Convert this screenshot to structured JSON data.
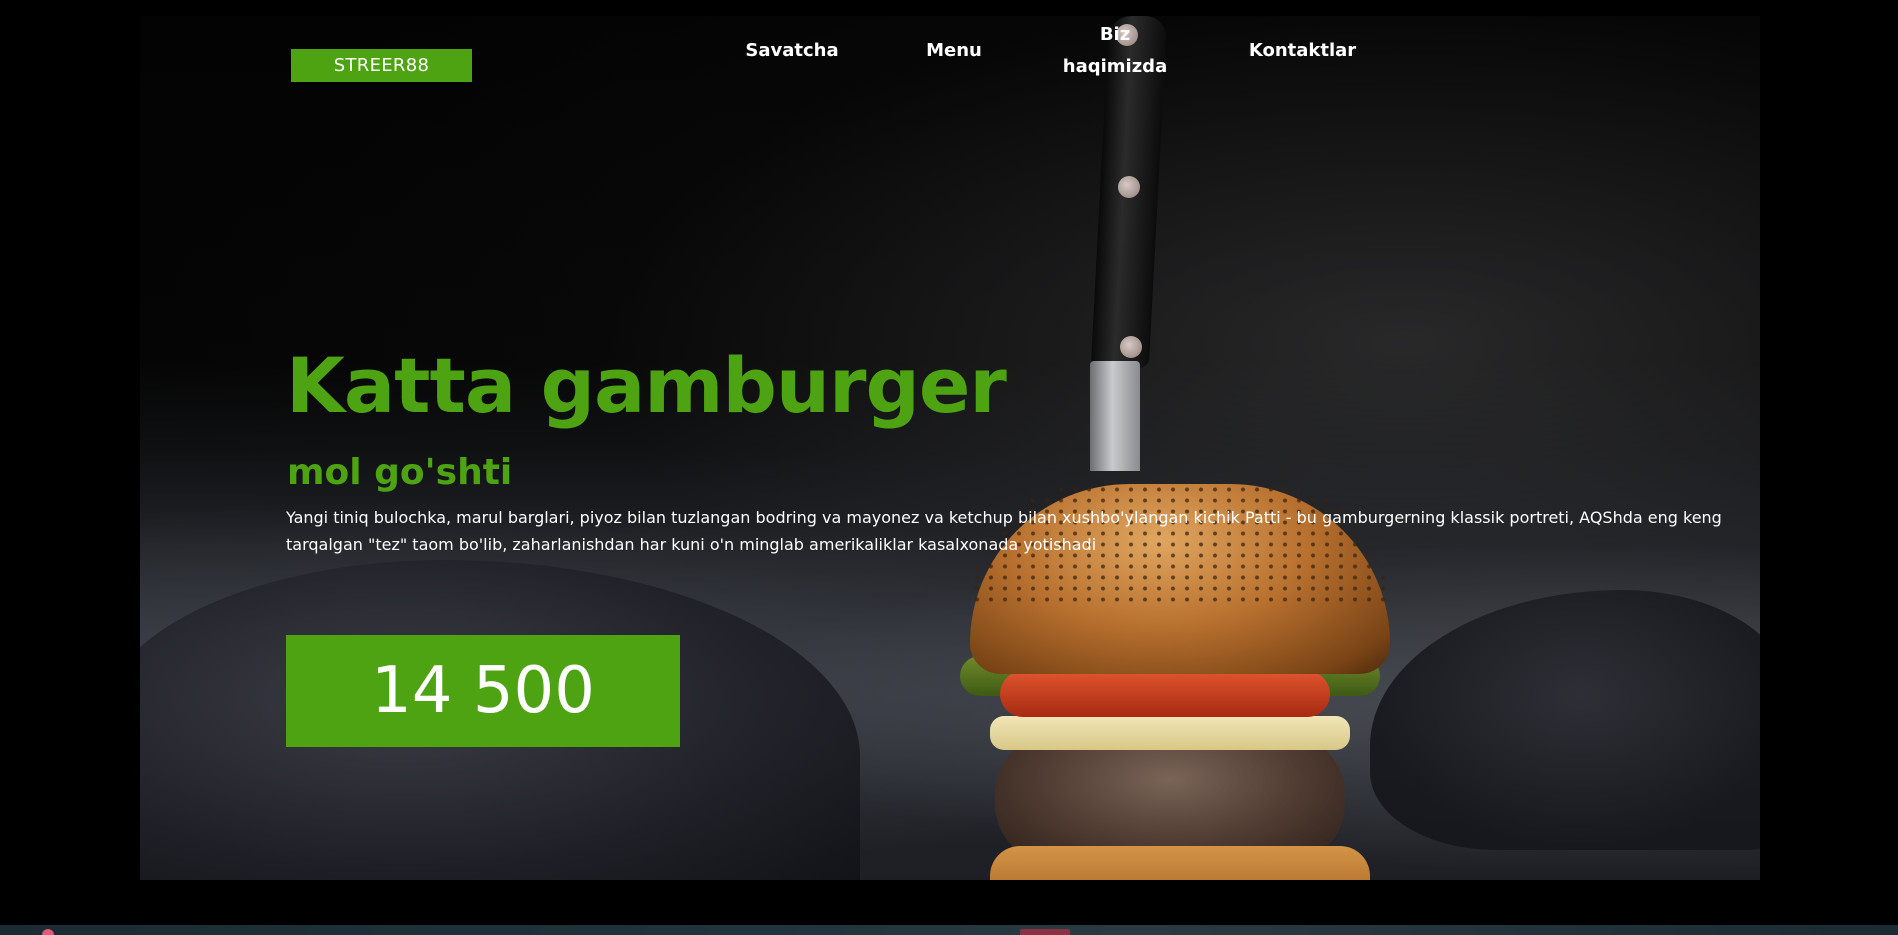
{
  "brand": {
    "logo_text": "STREER88",
    "accent_color": "#4ea312"
  },
  "nav": {
    "items": [
      {
        "label": "Savatcha"
      },
      {
        "label": "Menu"
      },
      {
        "label": "Biz haqimizda"
      },
      {
        "label": "Kontaktlar"
      }
    ]
  },
  "hero": {
    "title": "Katta gamburger",
    "subtitle": "mol go'shti",
    "description": "Yangi tiniq bulochka, marul barglari, piyoz bilan tuzlangan bodring va mayonez va ketchup bilan xushbo'ylangan kichik Patti - bu gamburgerning klassik portreti, AQShda eng keng tarqalgan \"tez\" taom bo'lib, zaharlanishdan har kuni o'n minglab amerikaliklar kasalxonada yotishadi",
    "price": "14 500",
    "image": "burger-with-knife-photo"
  }
}
